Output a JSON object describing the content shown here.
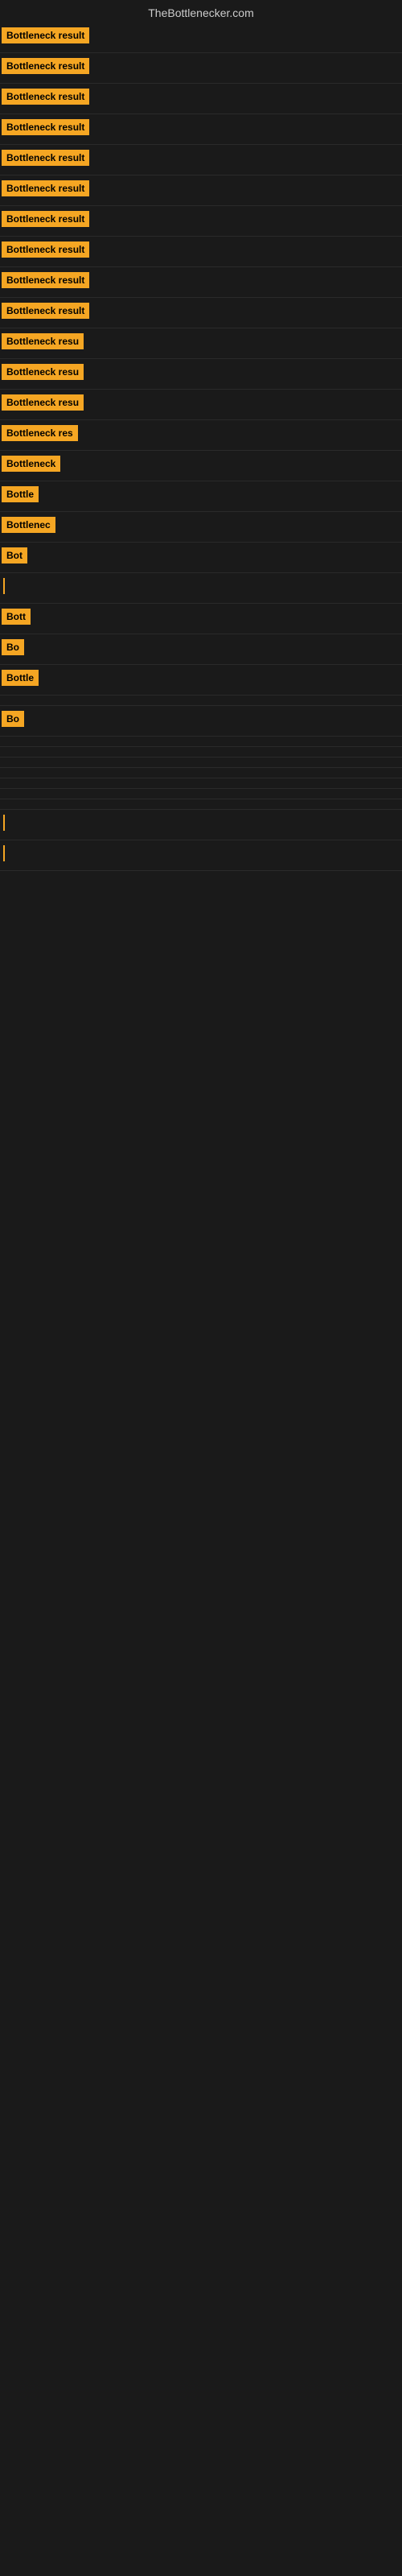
{
  "site": {
    "title": "TheBottlenecker.com"
  },
  "rows": [
    {
      "id": 1,
      "label": "Bottleneck result",
      "width": 151,
      "type": "badge"
    },
    {
      "id": 2,
      "label": "Bottleneck result",
      "width": 151,
      "type": "badge"
    },
    {
      "id": 3,
      "label": "Bottleneck result",
      "width": 151,
      "type": "badge"
    },
    {
      "id": 4,
      "label": "Bottleneck result",
      "width": 151,
      "type": "badge"
    },
    {
      "id": 5,
      "label": "Bottleneck result",
      "width": 151,
      "type": "badge"
    },
    {
      "id": 6,
      "label": "Bottleneck result",
      "width": 151,
      "type": "badge"
    },
    {
      "id": 7,
      "label": "Bottleneck result",
      "width": 151,
      "type": "badge"
    },
    {
      "id": 8,
      "label": "Bottleneck result",
      "width": 151,
      "type": "badge"
    },
    {
      "id": 9,
      "label": "Bottleneck result",
      "width": 151,
      "type": "badge"
    },
    {
      "id": 10,
      "label": "Bottleneck result",
      "width": 151,
      "type": "badge"
    },
    {
      "id": 11,
      "label": "Bottleneck resu",
      "width": 130,
      "type": "badge"
    },
    {
      "id": 12,
      "label": "Bottleneck resu",
      "width": 125,
      "type": "badge"
    },
    {
      "id": 13,
      "label": "Bottleneck resu",
      "width": 120,
      "type": "badge"
    },
    {
      "id": 14,
      "label": "Bottleneck res",
      "width": 110,
      "type": "badge"
    },
    {
      "id": 15,
      "label": "Bottleneck",
      "width": 90,
      "type": "badge"
    },
    {
      "id": 16,
      "label": "Bottle",
      "width": 60,
      "type": "badge"
    },
    {
      "id": 17,
      "label": "Bottlenec",
      "width": 80,
      "type": "badge"
    },
    {
      "id": 18,
      "label": "Bot",
      "width": 38,
      "type": "badge"
    },
    {
      "id": 19,
      "label": "",
      "width": 2,
      "type": "line"
    },
    {
      "id": 20,
      "label": "Bott",
      "width": 42,
      "type": "badge"
    },
    {
      "id": 21,
      "label": "Bo",
      "width": 28,
      "type": "badge"
    },
    {
      "id": 22,
      "label": "Bottle",
      "width": 58,
      "type": "badge"
    },
    {
      "id": 23,
      "label": "",
      "width": 0,
      "type": "empty"
    },
    {
      "id": 24,
      "label": "Bo",
      "width": 28,
      "type": "badge"
    },
    {
      "id": 25,
      "label": "",
      "width": 0,
      "type": "empty"
    },
    {
      "id": 26,
      "label": "",
      "width": 0,
      "type": "empty"
    },
    {
      "id": 27,
      "label": "",
      "width": 0,
      "type": "empty"
    },
    {
      "id": 28,
      "label": "",
      "width": 0,
      "type": "empty"
    },
    {
      "id": 29,
      "label": "",
      "width": 0,
      "type": "empty"
    },
    {
      "id": 30,
      "label": "",
      "width": 0,
      "type": "empty"
    },
    {
      "id": 31,
      "label": "",
      "width": 0,
      "type": "empty"
    },
    {
      "id": 32,
      "label": "",
      "width": 2,
      "type": "line"
    },
    {
      "id": 33,
      "label": "",
      "width": 2,
      "type": "line"
    }
  ]
}
